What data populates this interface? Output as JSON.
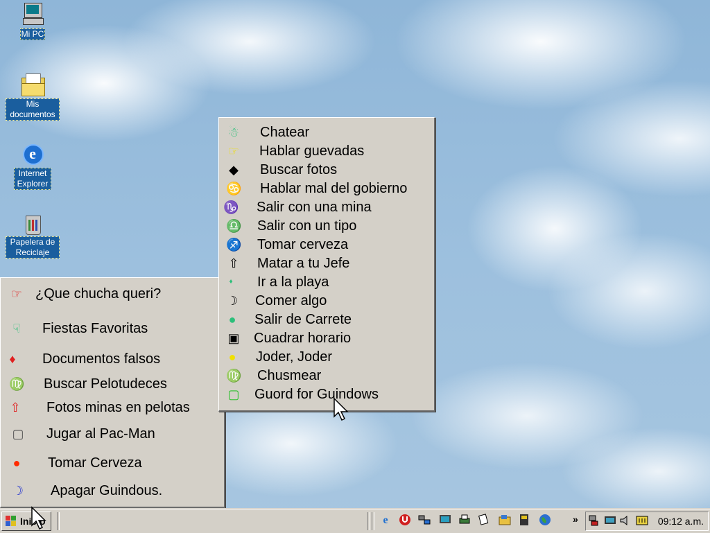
{
  "desktop": {
    "icons": [
      {
        "label": "Mi PC",
        "icon": "my-computer-icon"
      },
      {
        "label": "Mis documentos",
        "icon": "my-documents-icon"
      },
      {
        "label": "Internet Explorer",
        "icon": "internet-explorer-icon"
      },
      {
        "label": "Papelera de Reciclaje",
        "icon": "recycle-bin-icon"
      }
    ]
  },
  "submenu": {
    "items": [
      {
        "label": "Chatear",
        "glyph": "☃",
        "color": "#2cbf7a"
      },
      {
        "label": "Hablar guevadas",
        "glyph": "☞",
        "color": "#f0e000"
      },
      {
        "label": "Buscar fotos",
        "glyph": "◆",
        "color": "#000000"
      },
      {
        "label": "Hablar mal del gobierno",
        "glyph": "♋",
        "color": "#000000"
      },
      {
        "label": "Salir con una mina",
        "glyph": "♑",
        "color": "#f0e000"
      },
      {
        "label": "Salir con un tipo",
        "glyph": "♎",
        "color": "#2cbf7a"
      },
      {
        "label": "Tomar cerveza",
        "glyph": "♐",
        "color": "#3a4ad0"
      },
      {
        "label": "Matar a tu Jefe",
        "glyph": "⇧",
        "color": "#000000"
      },
      {
        "label": "Ir a la playa",
        "glyph": "♦",
        "color": "#2cbf7a"
      },
      {
        "label": "Comer algo",
        "glyph": "☽",
        "color": "#000000"
      },
      {
        "label": "Salir de Carrete",
        "glyph": "●",
        "color": "#2cbf7a"
      },
      {
        "label": "Cuadrar horario",
        "glyph": "▣",
        "color": "#000000"
      },
      {
        "label": "Joder, Joder",
        "glyph": "●",
        "color": "#f0e000"
      },
      {
        "label": "Chusmear",
        "glyph": "♍",
        "color": "#e02020"
      },
      {
        "label": "Guord for Guindows",
        "glyph": "▢",
        "color": "#2cbf2c"
      }
    ]
  },
  "startmenu": {
    "items": [
      {
        "label": "¿Que chucha queri?",
        "glyph": "☞",
        "color": "#e02020"
      },
      {
        "label": "Fiestas Favoritas",
        "glyph": "☟",
        "color": "#2cbf7a"
      },
      {
        "label": "Documentos falsos",
        "glyph": "♦",
        "color": "#e02020"
      },
      {
        "label": "Buscar Pelotudeces",
        "glyph": "♍",
        "color": "#f0e000"
      },
      {
        "label": "Fotos minas en pelotas",
        "glyph": "⇧",
        "color": "#e02020"
      },
      {
        "label": "Jugar al Pac-Man",
        "glyph": "▢",
        "color": "#555555"
      },
      {
        "label": "Tomar Cerveza",
        "glyph": "●",
        "color": "#ff2a00"
      },
      {
        "label": "Apagar Guindous.",
        "glyph": "☽",
        "color": "#2a3ad0"
      }
    ]
  },
  "taskbar": {
    "start_label": "Inicio",
    "quicklaunch_icons": [
      "internet-explorer-icon",
      "antivirus-icon",
      "network-icon",
      "monitor-icon",
      "printer-icon",
      "documents-icon",
      "folder-icon",
      "media-icon",
      "globe-icon"
    ],
    "overflow": "»",
    "tray_icons": [
      "network-tray-icon",
      "display-tray-icon",
      "volume-icon",
      "keyboard-icon"
    ],
    "clock": "09:12 a.m."
  }
}
